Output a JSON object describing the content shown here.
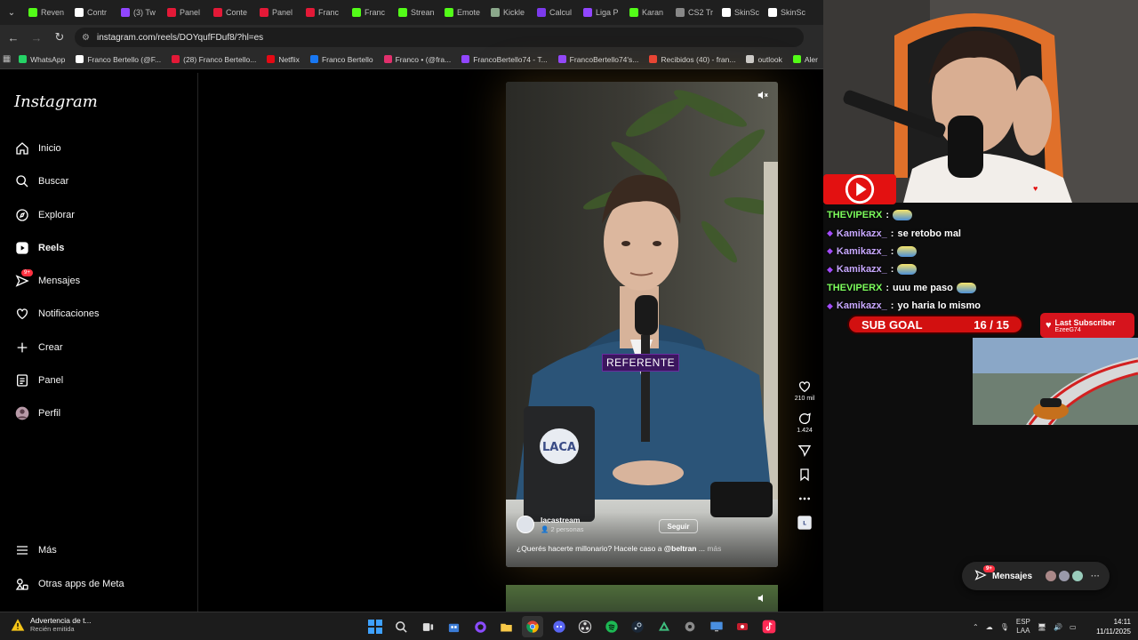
{
  "browser": {
    "tabs": [
      {
        "label": "Reven",
        "color": "#53fc18"
      },
      {
        "label": "Contr",
        "color": "#ffffff"
      },
      {
        "label": "(3) Tw",
        "color": "#9146ff"
      },
      {
        "label": "Panel",
        "color": "#e31937"
      },
      {
        "label": "Conte",
        "color": "#e31937"
      },
      {
        "label": "Panel",
        "color": "#e31937"
      },
      {
        "label": "Franc",
        "color": "#e31937"
      },
      {
        "label": "Franc",
        "color": "#53fc18"
      },
      {
        "label": "Strean",
        "color": "#53fc18"
      },
      {
        "label": "Emote",
        "color": "#53fc18"
      },
      {
        "label": "Kickle",
        "color": "#8ba88b"
      },
      {
        "label": "Calcul",
        "color": "#7c3aed"
      },
      {
        "label": "Liga P",
        "color": "#9146ff"
      },
      {
        "label": "Karan",
        "color": "#53fc18"
      },
      {
        "label": "CS2 Tr",
        "color": "#888888"
      },
      {
        "label": "SkinSc",
        "color": "#ffffff"
      },
      {
        "label": "SkinSc",
        "color": "#ffffff"
      }
    ],
    "url": "instagram.com/reels/DOYqufFDuf8/?hl=es",
    "bookmarks": [
      {
        "label": "WhatsApp",
        "color": "#25d366"
      },
      {
        "label": "Franco Bertello (@F...",
        "color": "#ffffff"
      },
      {
        "label": "(28) Franco Bertello...",
        "color": "#e31937"
      },
      {
        "label": "Netflix",
        "color": "#e50914"
      },
      {
        "label": "Franco Bertello",
        "color": "#1877f2"
      },
      {
        "label": "Franco • (@fra...",
        "color": "#e1306c"
      },
      {
        "label": "FrancoBertello74 - T...",
        "color": "#9146ff"
      },
      {
        "label": "FrancoBertello74's...",
        "color": "#9146ff"
      },
      {
        "label": "Recibidos (40) - fran...",
        "color": "#ea4335"
      },
      {
        "label": "outlook",
        "color": "#cccccc"
      },
      {
        "label": "Aler",
        "color": "#53fc18"
      }
    ]
  },
  "instagram": {
    "logo": "Instagram",
    "nav": [
      {
        "label": "Inicio",
        "icon": "home-icon"
      },
      {
        "label": "Buscar",
        "icon": "search-icon"
      },
      {
        "label": "Explorar",
        "icon": "compass-icon"
      },
      {
        "label": "Reels",
        "icon": "reels-icon"
      },
      {
        "label": "Mensajes",
        "icon": "messenger-icon",
        "badge": "9+"
      },
      {
        "label": "Notificaciones",
        "icon": "heart-icon"
      },
      {
        "label": "Crear",
        "icon": "plus-icon"
      },
      {
        "label": "Panel",
        "icon": "dashboard-icon"
      },
      {
        "label": "Perfil",
        "icon": "avatar"
      }
    ],
    "more": "Más",
    "meta_apps": "Otras apps de Meta",
    "reel": {
      "caption_tag": "REFERENTE",
      "author": "lacastream",
      "author_sub": "2 personas",
      "follow": "Seguir",
      "caption_prefix": "¿Querés hacerte millonario? Hacele caso a",
      "caption_mention": "@beltran",
      "caption_suffix": "...",
      "caption_more": "más",
      "likes": "210 mil",
      "comments": "1.424"
    },
    "messages_pill": {
      "label": "Mensajes",
      "badge": "9+"
    }
  },
  "stream": {
    "chat": [
      {
        "user": "THEVIPERX",
        "color": "green",
        "text": "",
        "emote": true,
        "mark": false
      },
      {
        "user": "Kamikazx_",
        "color": "purple",
        "text": "se retobo mal",
        "emote": false,
        "mark": true
      },
      {
        "user": "Kamikazx_",
        "color": "purple",
        "text": "",
        "emote": true,
        "mark": true
      },
      {
        "user": "Kamikazx_",
        "color": "purple",
        "text": "",
        "emote": true,
        "mark": true
      },
      {
        "user": "THEVIPERX",
        "color": "green",
        "text": "uuu me paso",
        "emote": true,
        "mark": false
      },
      {
        "user": "Kamikazx_",
        "color": "purple",
        "text": "yo haria lo mismo",
        "emote": false,
        "mark": true
      }
    ],
    "sub_goal": {
      "label": "SUB GOAL",
      "count": "16 / 15"
    },
    "last_subscriber": {
      "title": "Last Subscriber",
      "name": "EzeeG74"
    }
  },
  "taskbar": {
    "notification_title": "Advertencia de t...",
    "notification_sub": "Recién emitida",
    "lang": "ESP",
    "lang_sub": "LAA",
    "time": "14:11",
    "date": "11/11/2025"
  },
  "colors": {
    "instagram_red": "#ff3040",
    "stream_red": "#d21010",
    "chat_green": "#7cfc5c"
  }
}
